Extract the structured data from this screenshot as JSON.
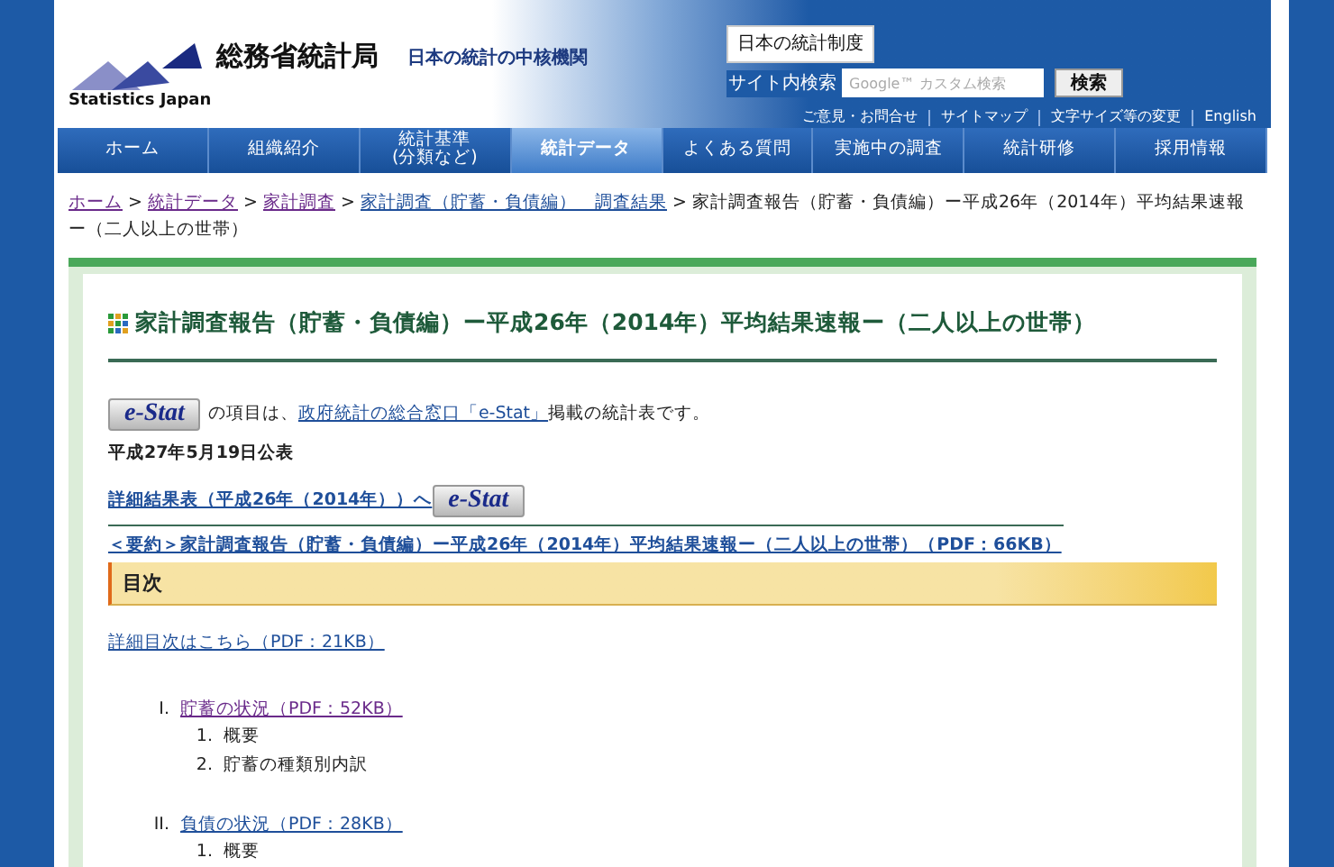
{
  "header": {
    "org_name": "総務省統計局",
    "org_name_en": "Statistics Japan",
    "tagline": "日本の統計の中核機関",
    "system_button": "日本の統計制度",
    "search_label": "サイト内検索",
    "search_placeholder": "Google™ カスタム検索",
    "search_button": "検索",
    "utility_links": [
      "ご意見・お問合せ",
      "サイトマップ",
      "文字サイズ等の変更",
      "English"
    ]
  },
  "nav": [
    {
      "label": "ホーム",
      "selected": false
    },
    {
      "label": "組織紹介",
      "selected": false
    },
    {
      "label": "統計基準\n(分類など)",
      "selected": false
    },
    {
      "label": "統計データ",
      "selected": true
    },
    {
      "label": "よくある質問",
      "selected": false
    },
    {
      "label": "実施中の調査",
      "selected": false
    },
    {
      "label": "統計研修",
      "selected": false
    },
    {
      "label": "採用情報",
      "selected": false
    }
  ],
  "breadcrumb": {
    "separator": ">",
    "links": [
      {
        "label": "ホーム",
        "visited": true
      },
      {
        "label": "統計データ",
        "visited": true
      },
      {
        "label": "家計調査",
        "visited": true
      },
      {
        "label": "家計調査（貯蓄・負債編）　調査結果",
        "visited": false
      }
    ],
    "current": "家計調査報告（貯蓄・負債編）ー平成26年（2014年）平均結果速報ー（二人以上の世帯）"
  },
  "content": {
    "title": "家計調査報告（貯蓄・負債編）ー平成26年（2014年）平均結果速報ー（二人以上の世帯）",
    "estat_note": {
      "badge": "e-Stat",
      "before": "の項目は、",
      "link": "政府統計の総合窓口「e-Stat」",
      "after": "掲載の統計表です。"
    },
    "published": "平成27年5月19日公表",
    "detail_link": {
      "label": "詳細結果表（平成26年（2014年））へ",
      "badge": "e-Stat"
    },
    "summary_link": "＜要約＞家計調査報告（貯蓄・負債編）ー平成26年（2014年）平均結果速報ー（二人以上の世帯）（PDF：66KB）",
    "toc_heading": "目次",
    "toc_detail_link": "詳細目次はこちら（PDF：21KB）",
    "sections": [
      {
        "marker": "I.",
        "label": "貯蓄の状況（PDF：52KB）",
        "visited": true,
        "children": [
          {
            "marker": "1.",
            "label": "概要"
          },
          {
            "marker": "2.",
            "label": "貯蓄の種類別内訳"
          }
        ]
      },
      {
        "marker": "II.",
        "label": "負債の状況（PDF：28KB）",
        "visited": false,
        "children": [
          {
            "marker": "1.",
            "label": "概要"
          }
        ]
      }
    ]
  }
}
